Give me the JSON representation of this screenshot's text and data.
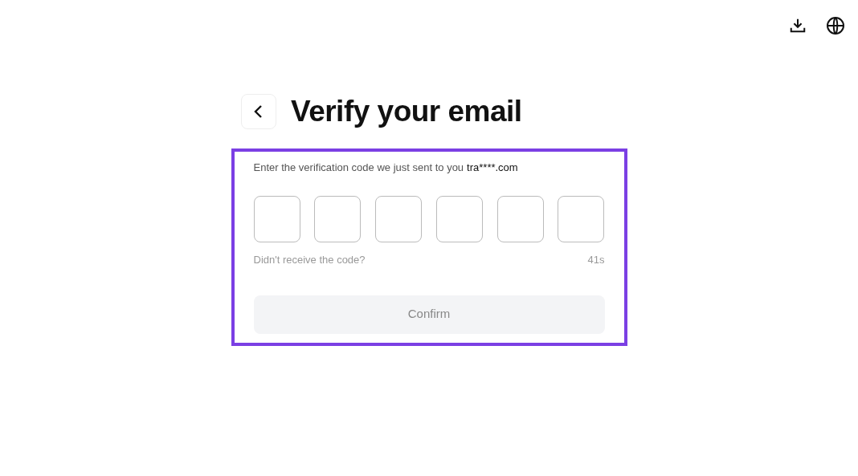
{
  "header": {
    "title": "Verify your email"
  },
  "form": {
    "prompt": "Enter the verification code we just sent to you",
    "email": "tra****.com",
    "code_fields": [
      {
        "focused": false
      },
      {
        "focused": false
      },
      {
        "focused": false
      },
      {
        "focused": false
      },
      {
        "focused": false
      },
      {
        "focused": false
      }
    ],
    "resend": "Didn't receive the code?",
    "countdown": "41s",
    "confirm": {
      "label": "Confirm",
      "disabled": true
    }
  }
}
